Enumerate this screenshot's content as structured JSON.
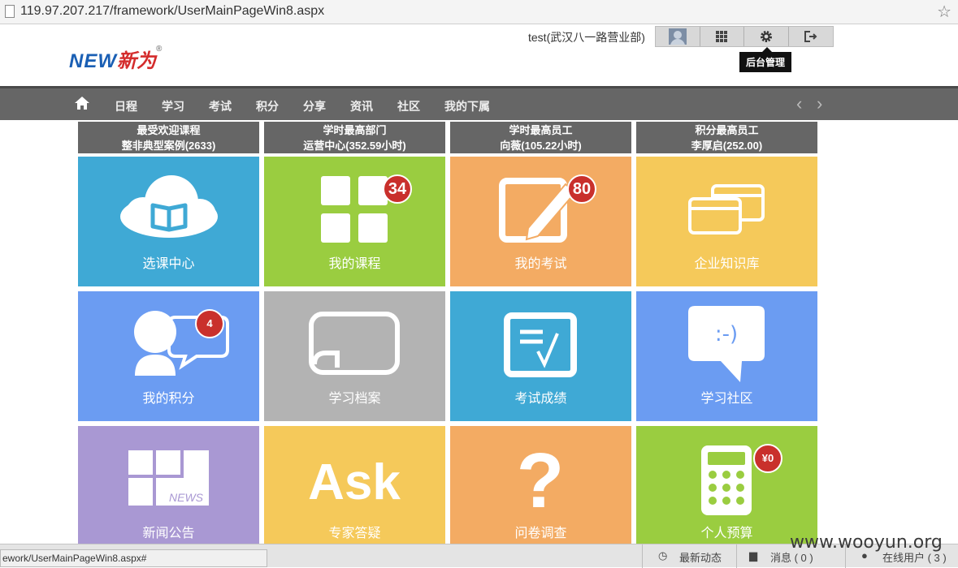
{
  "browser": {
    "url": "119.97.207.217/framework/UserMainPageWin8.aspx"
  },
  "header": {
    "logo_new": "NEW",
    "logo_cn": "新为",
    "logo_reg": "®",
    "user": "test(武汉八一路营业部)",
    "tooltip": "后台管理"
  },
  "nav": {
    "items": [
      "日程",
      "学习",
      "考试",
      "积分",
      "分享",
      "资讯",
      "社区",
      "我的下属"
    ],
    "prev": "‹",
    "next": "›"
  },
  "stats": [
    {
      "title": "最受欢迎课程",
      "value": "整非典型案例(2633)"
    },
    {
      "title": "学时最高部门",
      "value": "运营中心(352.59小时)"
    },
    {
      "title": "学时最高员工",
      "value": "向薇(105.22小时)"
    },
    {
      "title": "积分最高员工",
      "value": "李厚启(252.00)"
    }
  ],
  "tiles": [
    {
      "label": "选课中心",
      "color": "#3fa9d5",
      "icon": "cloud-book-icon"
    },
    {
      "label": "我的课程",
      "color": "#9acd40",
      "icon": "grid-icon",
      "badge": "34"
    },
    {
      "label": "我的考试",
      "color": "#f3ab63",
      "icon": "pencil-icon",
      "badge": "80"
    },
    {
      "label": "企业知识库",
      "color": "#f5c95a",
      "icon": "cards-icon"
    },
    {
      "label": "我的积分",
      "color": "#6b9cf2",
      "icon": "person-bubble-icon",
      "badge": "4"
    },
    {
      "label": "学习档案",
      "color": "#b3b3b3",
      "icon": "scroll-icon"
    },
    {
      "label": "考试成绩",
      "color": "#3fa9d5",
      "icon": "checklist-icon"
    },
    {
      "label": "学习社区",
      "color": "#6b9cf2",
      "icon": "chat-smile-icon",
      "icon_text": ":-)"
    },
    {
      "label": "新闻公告",
      "color": "#a998d3",
      "icon": "news-icon",
      "icon_text": "NEWS"
    },
    {
      "label": "专家答疑",
      "color": "#f5c95a",
      "icon": "ask-icon",
      "icon_text": "Ask"
    },
    {
      "label": "问卷调查",
      "color": "#f3ab63",
      "icon": "question-icon",
      "icon_text": "?"
    },
    {
      "label": "个人预算",
      "color": "#9acd40",
      "icon": "calculator-icon",
      "badge": "¥0"
    }
  ],
  "statusbar": {
    "link": "ework/UserMainPageWin8.aspx#",
    "recent": "最新动态",
    "messages": "消息 ( 0 )",
    "online": "在线用户 ( 3 )"
  },
  "watermark": "www.wooyun.org"
}
